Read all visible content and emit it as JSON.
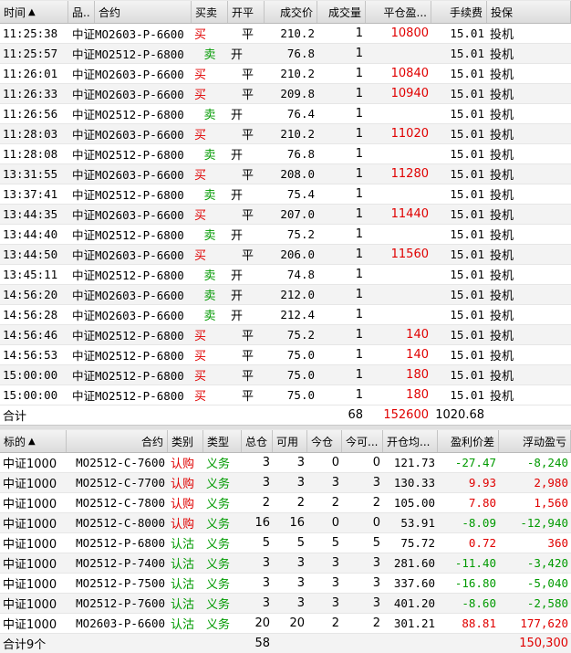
{
  "trades": {
    "headers": {
      "time": "时间",
      "sort": "▲",
      "product": "品..",
      "contract": "合约",
      "side": "买卖",
      "offset": "开平",
      "price": "成交价",
      "qty": "成交量",
      "close_pnl": "平仓盈...",
      "fee": "手续费",
      "hedge": "投保"
    },
    "rows": [
      {
        "time": "11:25:38",
        "contract": "中证MO2603-P-6600",
        "side": "买",
        "offset": "平",
        "price": "210.2",
        "qty": "1",
        "close_pnl": "10800",
        "fee": "15.01",
        "hedge": "投机"
      },
      {
        "time": "11:25:57",
        "contract": "中证MO2512-P-6800",
        "side": "卖",
        "offset": "开",
        "price": "76.8",
        "qty": "1",
        "close_pnl": "",
        "fee": "15.01",
        "hedge": "投机"
      },
      {
        "time": "11:26:01",
        "contract": "中证MO2603-P-6600",
        "side": "买",
        "offset": "平",
        "price": "210.2",
        "qty": "1",
        "close_pnl": "10840",
        "fee": "15.01",
        "hedge": "投机"
      },
      {
        "time": "11:26:33",
        "contract": "中证MO2603-P-6600",
        "side": "买",
        "offset": "平",
        "price": "209.8",
        "qty": "1",
        "close_pnl": "10940",
        "fee": "15.01",
        "hedge": "投机"
      },
      {
        "time": "11:26:56",
        "contract": "中证MO2512-P-6800",
        "side": "卖",
        "offset": "开",
        "price": "76.4",
        "qty": "1",
        "close_pnl": "",
        "fee": "15.01",
        "hedge": "投机"
      },
      {
        "time": "11:28:03",
        "contract": "中证MO2603-P-6600",
        "side": "买",
        "offset": "平",
        "price": "210.2",
        "qty": "1",
        "close_pnl": "11020",
        "fee": "15.01",
        "hedge": "投机"
      },
      {
        "time": "11:28:08",
        "contract": "中证MO2512-P-6800",
        "side": "卖",
        "offset": "开",
        "price": "76.8",
        "qty": "1",
        "close_pnl": "",
        "fee": "15.01",
        "hedge": "投机"
      },
      {
        "time": "13:31:55",
        "contract": "中证MO2603-P-6600",
        "side": "买",
        "offset": "平",
        "price": "208.0",
        "qty": "1",
        "close_pnl": "11280",
        "fee": "15.01",
        "hedge": "投机"
      },
      {
        "time": "13:37:41",
        "contract": "中证MO2512-P-6800",
        "side": "卖",
        "offset": "开",
        "price": "75.4",
        "qty": "1",
        "close_pnl": "",
        "fee": "15.01",
        "hedge": "投机"
      },
      {
        "time": "13:44:35",
        "contract": "中证MO2603-P-6600",
        "side": "买",
        "offset": "平",
        "price": "207.0",
        "qty": "1",
        "close_pnl": "11440",
        "fee": "15.01",
        "hedge": "投机"
      },
      {
        "time": "13:44:40",
        "contract": "中证MO2512-P-6800",
        "side": "卖",
        "offset": "开",
        "price": "75.2",
        "qty": "1",
        "close_pnl": "",
        "fee": "15.01",
        "hedge": "投机"
      },
      {
        "time": "13:44:50",
        "contract": "中证MO2603-P-6600",
        "side": "买",
        "offset": "平",
        "price": "206.0",
        "qty": "1",
        "close_pnl": "11560",
        "fee": "15.01",
        "hedge": "投机"
      },
      {
        "time": "13:45:11",
        "contract": "中证MO2512-P-6800",
        "side": "卖",
        "offset": "开",
        "price": "74.8",
        "qty": "1",
        "close_pnl": "",
        "fee": "15.01",
        "hedge": "投机"
      },
      {
        "time": "14:56:20",
        "contract": "中证MO2603-P-6600",
        "side": "卖",
        "offset": "开",
        "price": "212.0",
        "qty": "1",
        "close_pnl": "",
        "fee": "15.01",
        "hedge": "投机"
      },
      {
        "time": "14:56:28",
        "contract": "中证MO2603-P-6600",
        "side": "卖",
        "offset": "开",
        "price": "212.4",
        "qty": "1",
        "close_pnl": "",
        "fee": "15.01",
        "hedge": "投机"
      },
      {
        "time": "14:56:46",
        "contract": "中证MO2512-P-6800",
        "side": "买",
        "offset": "平",
        "price": "75.2",
        "qty": "1",
        "close_pnl": "140",
        "fee": "15.01",
        "hedge": "投机"
      },
      {
        "time": "14:56:53",
        "contract": "中证MO2512-P-6800",
        "side": "买",
        "offset": "平",
        "price": "75.0",
        "qty": "1",
        "close_pnl": "140",
        "fee": "15.01",
        "hedge": "投机"
      },
      {
        "time": "15:00:00",
        "contract": "中证MO2512-P-6800",
        "side": "买",
        "offset": "平",
        "price": "75.0",
        "qty": "1",
        "close_pnl": "180",
        "fee": "15.01",
        "hedge": "投机"
      },
      {
        "time": "15:00:00",
        "contract": "中证MO2512-P-6800",
        "side": "买",
        "offset": "平",
        "price": "75.0",
        "qty": "1",
        "close_pnl": "180",
        "fee": "15.01",
        "hedge": "投机"
      }
    ],
    "total": {
      "label": "合计",
      "qty": "68",
      "close_pnl": "152600",
      "fee": "1020.68"
    }
  },
  "positions": {
    "headers": {
      "underlying": "标的",
      "sort": "▲",
      "contract": "合约",
      "category": "类别",
      "type": "类型",
      "total": "总仓",
      "avail": "可用",
      "today": "今仓",
      "today_avail": "今可...",
      "open_avg": "开仓均...",
      "profit_diff": "盈利价差",
      "float_pnl": "浮动盈亏"
    },
    "rows": [
      {
        "underlying": "中证1000",
        "contract": "MO2512-C-7600",
        "category": "认购",
        "type": "义务",
        "total": "3",
        "avail": "3",
        "today": "0",
        "today_avail": "0",
        "open_avg": "121.73",
        "profit_diff": "-27.47",
        "float_pnl": "-8,240"
      },
      {
        "underlying": "中证1000",
        "contract": "MO2512-C-7700",
        "category": "认购",
        "type": "义务",
        "total": "3",
        "avail": "3",
        "today": "3",
        "today_avail": "3",
        "open_avg": "130.33",
        "profit_diff": "9.93",
        "float_pnl": "2,980"
      },
      {
        "underlying": "中证1000",
        "contract": "MO2512-C-7800",
        "category": "认购",
        "type": "义务",
        "total": "2",
        "avail": "2",
        "today": "2",
        "today_avail": "2",
        "open_avg": "105.00",
        "profit_diff": "7.80",
        "float_pnl": "1,560"
      },
      {
        "underlying": "中证1000",
        "contract": "MO2512-C-8000",
        "category": "认购",
        "type": "义务",
        "total": "16",
        "avail": "16",
        "today": "0",
        "today_avail": "0",
        "open_avg": "53.91",
        "profit_diff": "-8.09",
        "float_pnl": "-12,940"
      },
      {
        "underlying": "中证1000",
        "contract": "MO2512-P-6800",
        "category": "认沽",
        "type": "义务",
        "total": "5",
        "avail": "5",
        "today": "5",
        "today_avail": "5",
        "open_avg": "75.72",
        "profit_diff": "0.72",
        "float_pnl": "360"
      },
      {
        "underlying": "中证1000",
        "contract": "MO2512-P-7400",
        "category": "认沽",
        "type": "义务",
        "total": "3",
        "avail": "3",
        "today": "3",
        "today_avail": "3",
        "open_avg": "281.60",
        "profit_diff": "-11.40",
        "float_pnl": "-3,420"
      },
      {
        "underlying": "中证1000",
        "contract": "MO2512-P-7500",
        "category": "认沽",
        "type": "义务",
        "total": "3",
        "avail": "3",
        "today": "3",
        "today_avail": "3",
        "open_avg": "337.60",
        "profit_diff": "-16.80",
        "float_pnl": "-5,040"
      },
      {
        "underlying": "中证1000",
        "contract": "MO2512-P-7600",
        "category": "认沽",
        "type": "义务",
        "total": "3",
        "avail": "3",
        "today": "3",
        "today_avail": "3",
        "open_avg": "401.20",
        "profit_diff": "-8.60",
        "float_pnl": "-2,580"
      },
      {
        "underlying": "中证1000",
        "contract": "MO2603-P-6600",
        "category": "认沽",
        "type": "义务",
        "total": "20",
        "avail": "20",
        "today": "2",
        "today_avail": "2",
        "open_avg": "301.21",
        "profit_diff": "88.81",
        "float_pnl": "177,620"
      }
    ],
    "total": {
      "label": "合计9个",
      "total": "58",
      "float_pnl": "150,300"
    }
  },
  "colors": {
    "buy": "#e00000",
    "sell": "#009a00",
    "positive": "#e00000",
    "negative": "#009a00"
  }
}
